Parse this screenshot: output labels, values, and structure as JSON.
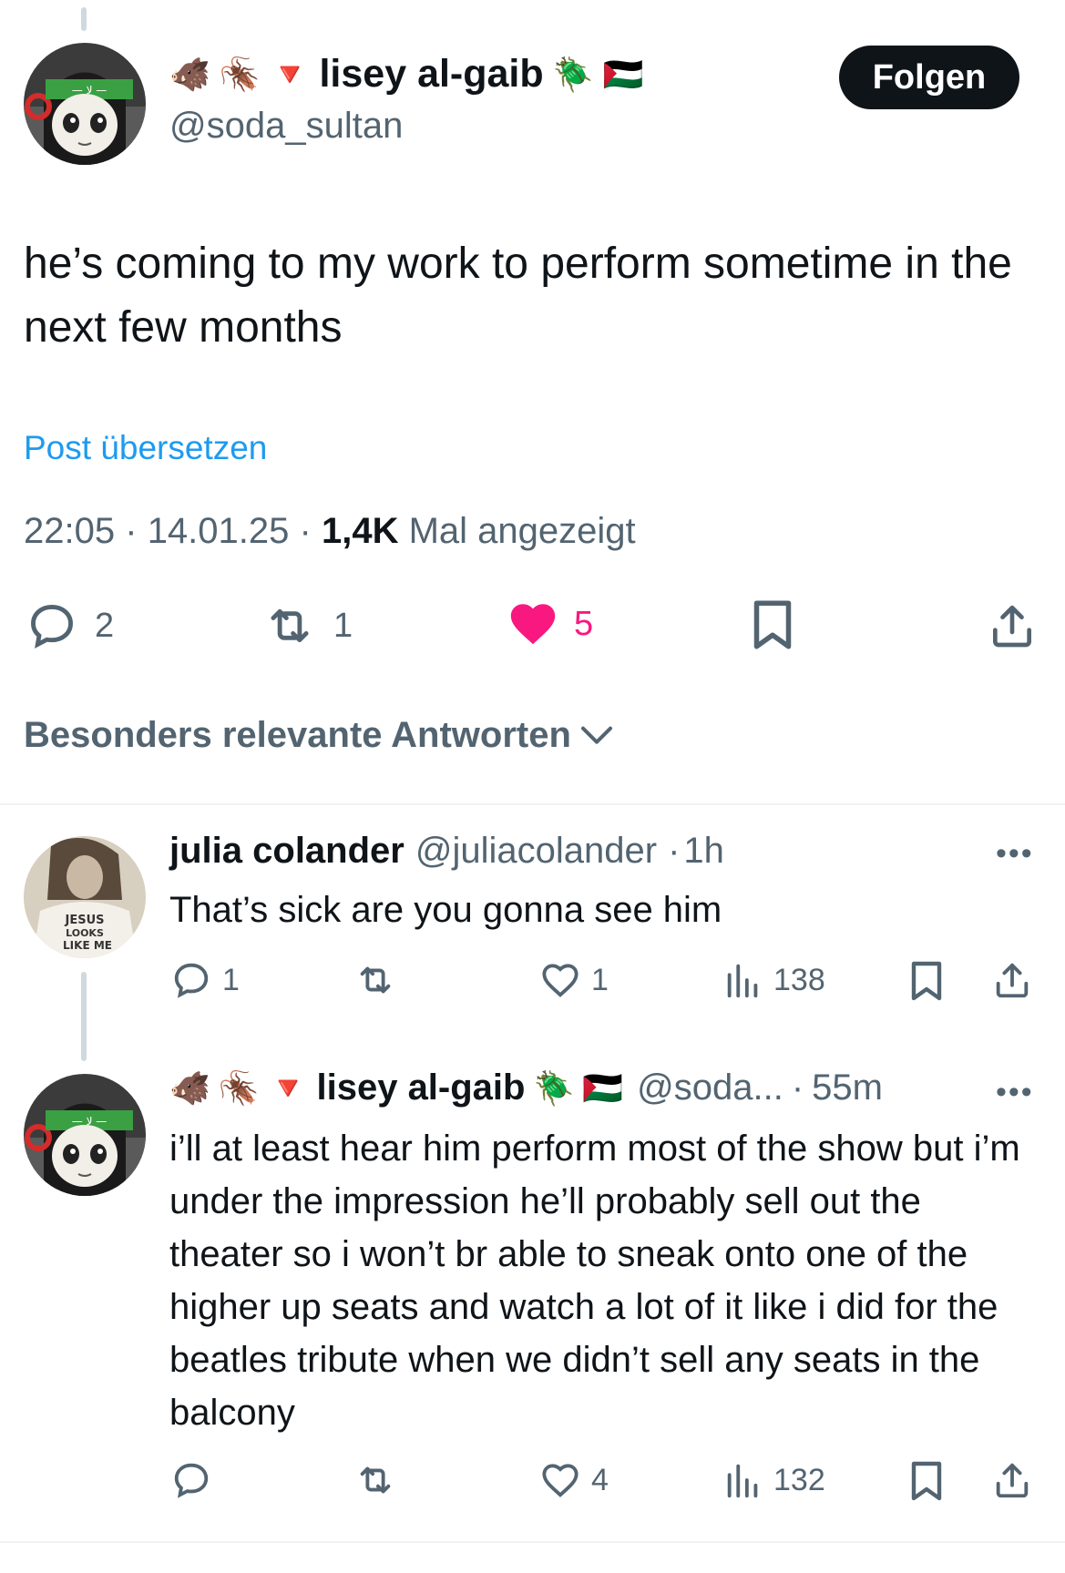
{
  "post": {
    "author": {
      "display_name": "lisey al-gaib",
      "prefix_emojis": [
        "🐗",
        "🪳",
        "🔻"
      ],
      "suffix_emojis": [
        "🪲",
        "🇵🇸"
      ],
      "handle": "@soda_sultan"
    },
    "follow_label": "Folgen",
    "text": "he’s coming to my work to perform sometime in the next few months",
    "translate_label": "Post übersetzen",
    "time": "22:05",
    "date": "14.01.25",
    "views_count": "1,4K",
    "views_label": "Mal angezeigt",
    "separator": "·",
    "actions": {
      "replies": "2",
      "reposts": "1",
      "likes": "5"
    }
  },
  "sort": {
    "label": "Besonders relevante Antworten"
  },
  "replies": [
    {
      "display_name": "julia colander",
      "handle": "@juliacolander",
      "time": "1h",
      "avatar_shirt_text": [
        "JESUS",
        "LOOKS",
        "LIKE ME"
      ],
      "text": "That’s sick are you gonna see him",
      "actions": {
        "replies": "1",
        "reposts": "",
        "likes": "1",
        "views": "138"
      }
    },
    {
      "display_name": "lisey al-gaib",
      "prefix_emojis": [
        "🐗",
        "🪳",
        "🔻"
      ],
      "suffix_emojis": [
        "🪲",
        "🇵🇸"
      ],
      "handle": "@soda...",
      "time": "55m",
      "text": "i’ll at least hear him perform most of the show but i’m under the impression he’ll probably sell out the theater so i won’t br able to sneak onto one of the higher up seats and watch a lot of it like i did for the beatles tribute when we didn’t sell any seats in the balcony",
      "actions": {
        "replies": "",
        "reposts": "",
        "likes": "4",
        "views": "132"
      }
    }
  ],
  "colors": {
    "text": "#0f1419",
    "secondary": "#536471",
    "link": "#1d9bf0",
    "like": "#f91880",
    "divider": "#eff3f4"
  }
}
